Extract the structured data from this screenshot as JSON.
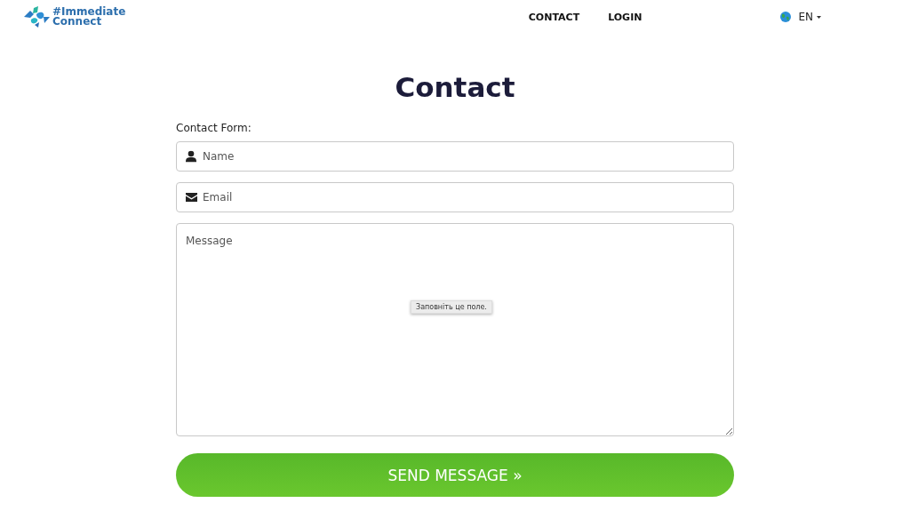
{
  "header": {
    "logo_lines": [
      "#Immediate",
      "Connect"
    ],
    "nav": [
      {
        "label": "CONTACT"
      },
      {
        "label": "LOGIN"
      }
    ],
    "language": {
      "label": "EN"
    }
  },
  "heading": "Contact",
  "form": {
    "label": "Contact Form:",
    "fields": [
      {
        "kind": "name",
        "placeholder": "Name"
      },
      {
        "kind": "email",
        "placeholder": "Email"
      },
      {
        "kind": "message",
        "placeholder": "Message",
        "tooltip": "Заповніть це поле."
      }
    ],
    "submit": "SEND MESSAGE »"
  }
}
